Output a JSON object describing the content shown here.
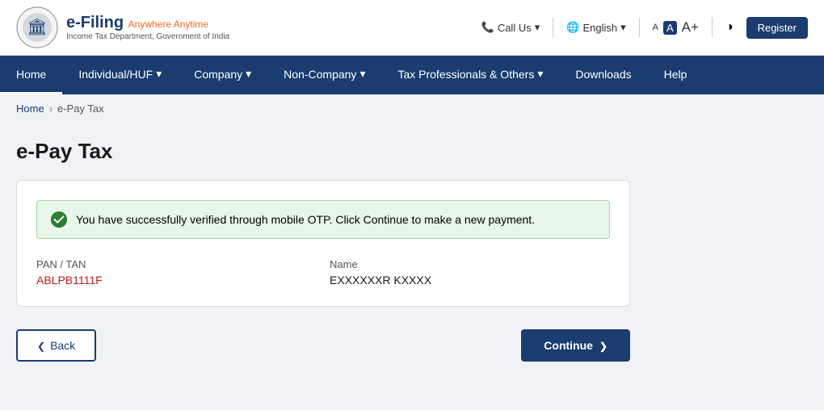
{
  "header": {
    "logo_title": "e-Filing",
    "logo_tagline": "Anywhere Anytime",
    "logo_subtitle": "Income Tax Department, Government of India",
    "call_us": "Call Us",
    "language": "English",
    "font_small": "A",
    "font_medium": "A",
    "font_large": "A+",
    "register": "Register"
  },
  "navbar": {
    "items": [
      {
        "label": "Home",
        "active": true,
        "has_arrow": false
      },
      {
        "label": "Individual/HUF",
        "active": false,
        "has_arrow": true
      },
      {
        "label": "Company",
        "active": false,
        "has_arrow": true
      },
      {
        "label": "Non-Company",
        "active": false,
        "has_arrow": true
      },
      {
        "label": "Tax Professionals & Others",
        "active": false,
        "has_arrow": true
      },
      {
        "label": "Downloads",
        "active": false,
        "has_arrow": false
      },
      {
        "label": "Help",
        "active": false,
        "has_arrow": false
      }
    ]
  },
  "breadcrumb": {
    "home": "Home",
    "current": "e-Pay Tax"
  },
  "page": {
    "title": "e-Pay Tax",
    "success_message": "You have successfully verified through mobile OTP. Click ",
    "success_link": "Continue",
    "success_suffix": " to make a new payment.",
    "pan_tan_label": "PAN / TAN",
    "pan_tan_value": "ABLPB1111F",
    "name_label": "Name",
    "name_value": "EXXXXXXR KXXXX",
    "back_label": "Back",
    "continue_label": "Continue"
  }
}
